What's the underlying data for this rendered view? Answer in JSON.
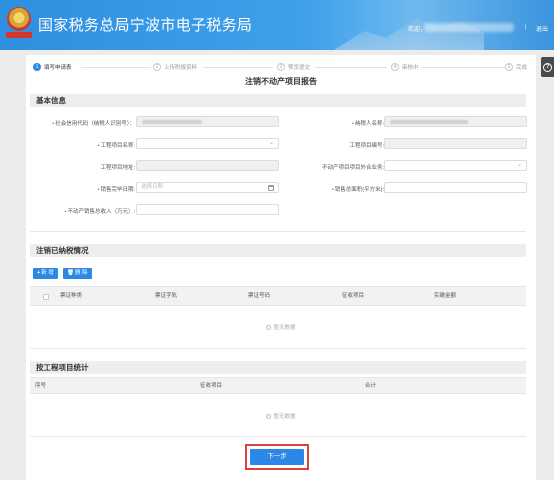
{
  "header": {
    "site_title": "国家税务总局宁波市电子税务局",
    "welcome": "欢迎，",
    "separator": "|",
    "logout": "退出",
    "logo_caption": "中国税务"
  },
  "help": {
    "icon": "?"
  },
  "steps": [
    {
      "num": "1",
      "label": "填写申请表",
      "active": true
    },
    {
      "num": "2",
      "label": "上传附报资料",
      "active": false
    },
    {
      "num": "3",
      "label": "预览提交",
      "active": false
    },
    {
      "num": "4",
      "label": "审核中",
      "active": false
    },
    {
      "num": "5",
      "label": "完成",
      "active": false
    }
  ],
  "form_title": "注销不动产项目报告",
  "basic_info": {
    "title": "基本信息",
    "fields": {
      "credit_code": {
        "label": "社会信用代码（纳税人识别号）：",
        "required": true
      },
      "taxpayer_name": {
        "label": "纳税人名称:",
        "required": true
      },
      "project_name": {
        "label": "工程项目名称:",
        "required": true,
        "placeholder": ""
      },
      "project_code": {
        "label": "工程项目编号:",
        "required": false
      },
      "project_address": {
        "label": "工程项目地址:",
        "required": false
      },
      "project_type": {
        "label": "不动产项目项目外合业务:",
        "required": false
      },
      "sale_end_date": {
        "label": "销售完毕日期:",
        "required": true,
        "placeholder": "选择日期"
      },
      "sale_area": {
        "label": "销售总面积(平方米):",
        "required": true
      },
      "sale_income": {
        "label": "不动产销售总收入（万元）:",
        "required": true
      }
    }
  },
  "tax_paid": {
    "title": "注销已纳税情况",
    "add_label": "新 增",
    "delete_label": "删 除",
    "columns": [
      "票证种类",
      "票证字轨",
      "票证号码",
      "征收项目",
      "实缴金额"
    ],
    "empty_text": "暂无数据"
  },
  "stats": {
    "title": "按工程项目统计",
    "columns": [
      "序号",
      "征收项目",
      "合计"
    ],
    "empty_text": "暂无数据"
  },
  "next_button": "下一步",
  "colors": {
    "primary": "#2b88e6",
    "header": "#3a97e4",
    "highlight": "#e23e3e",
    "required": "#e04a3c"
  }
}
